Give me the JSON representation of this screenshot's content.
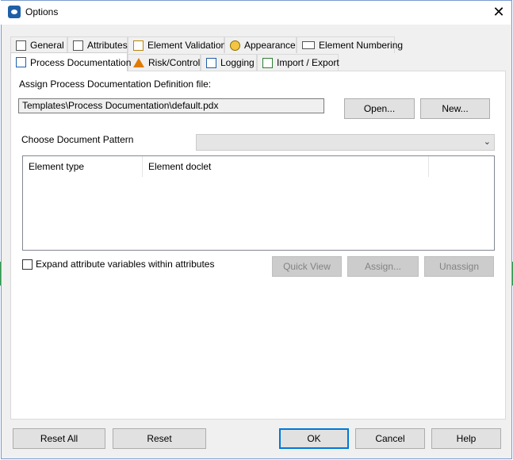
{
  "window": {
    "title": "Options",
    "close_label": "✕"
  },
  "tabs_row1": [
    {
      "label": "General",
      "icon": "general-icon"
    },
    {
      "label": "Attributes",
      "icon": "attributes-icon"
    },
    {
      "label": "Element Validation",
      "icon": "element-validation-icon"
    },
    {
      "label": "Appearance",
      "icon": "appearance-icon"
    },
    {
      "label": "Element Numbering",
      "icon": "element-numbering-icon"
    }
  ],
  "tabs_row2": [
    {
      "label": "Process Documentation",
      "icon": "process-documentation-icon",
      "active": true
    },
    {
      "label": "Risk/Control",
      "icon": "risk-control-icon"
    },
    {
      "label": "Logging",
      "icon": "logging-icon"
    },
    {
      "label": "Import / Export",
      "icon": "import-export-icon"
    }
  ],
  "process_doc": {
    "assign_label": "Assign Process Documentation Definition file:",
    "file_path": "Templates\\Process Documentation\\default.pdx",
    "open_button": "Open...",
    "new_button": "New...",
    "pattern_label": "Choose Document Pattern",
    "pattern_value": "",
    "columns": [
      "Element type",
      "Element doclet",
      ""
    ],
    "expand_label": "Expand attribute variables within attributes",
    "expand_checked": false,
    "quick_view_button": "Quick View",
    "assign_button": "Assign...",
    "unassign_button": "Unassign"
  },
  "footer": {
    "reset_all": "Reset All",
    "reset": "Reset",
    "ok": "OK",
    "cancel": "Cancel",
    "help": "Help"
  },
  "colors": {
    "accent": "#0078d7",
    "window_border": "#7a9ccf"
  }
}
